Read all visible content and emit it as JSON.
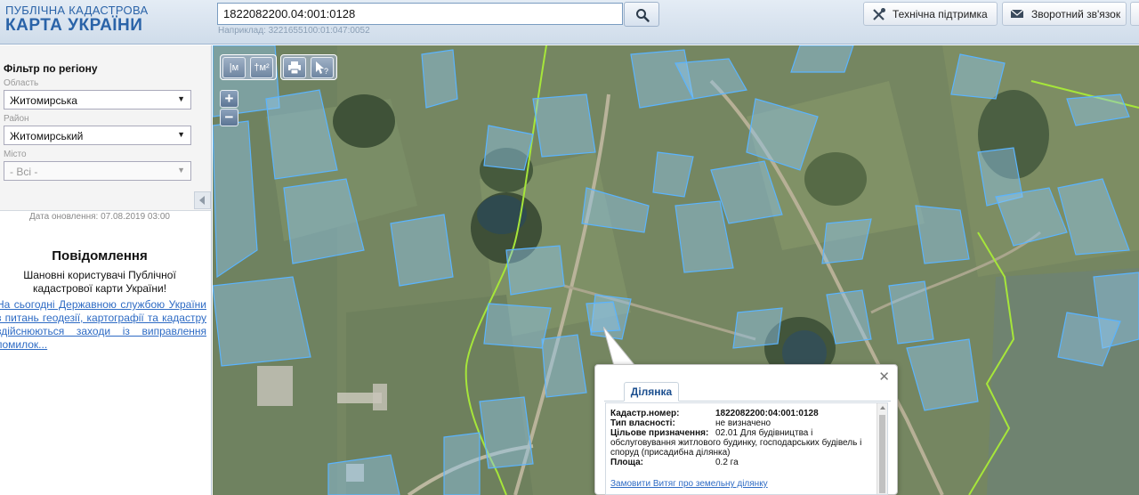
{
  "header": {
    "logo_line1": "ПУБЛІЧНА КАДАСТРОВА",
    "logo_line2": "КАРТА УКРАЇНИ",
    "search_value": "1822082200.04:001:0128",
    "search_icon": "magnifier-icon",
    "example_text": "Наприклад: 3221655100:01:047:0052",
    "support_label": "Технічна підтримка",
    "support_icon": "tools-icon",
    "feedback_label": "Зворотний зв'язок",
    "feedback_icon": "envelope-icon"
  },
  "filter": {
    "title": "Фільтр по регіону",
    "oblast_label": "Область",
    "oblast_value": "Житомирська",
    "rayon_label": "Район",
    "rayon_value": "Житомирський",
    "misto_label": "Місто",
    "misto_value": "- Всі -"
  },
  "sidebar": {
    "update_date": "Дата оновлення: 07.08.2019 03:00",
    "message_title": "Повідомлення",
    "message_body": "Шановні користувачі Публічної кадастрової карти України!",
    "message_link": "На сьогодні Державною службою України з питань геодезії, картографії та кадастру здійснюються заходи із виправлення помилок..."
  },
  "map_tools": {
    "measure_length": "м",
    "measure_area": "м²",
    "print_icon": "printer-icon",
    "info_icon": "pointer-question-icon",
    "zoom_in": "+",
    "zoom_out": "−"
  },
  "popup": {
    "tab_label": "Ділянка",
    "close_label": "✕",
    "fields": {
      "cadastral_label": "Кадастр.номер:",
      "cadastral_value": "1822082200:04:001:0128",
      "ownership_label": "Тип власності:",
      "ownership_value": "не визначено",
      "purpose_label": "Цільове призначення:",
      "purpose_value": "02.01 Для будівництва і обслуговування житлового будинку, господарських будівель і споруд (присадибна ділянка)",
      "area_label": "Площа:",
      "area_value": "0.2 га"
    },
    "order_link": "Замовити Витяг про земельну ділянку"
  },
  "colors": {
    "parcel_stroke": "#5ab4ff",
    "parcel_fill": "#8ec6ee",
    "boundary_green": "#a6e63a",
    "header_blue": "#2a63a8",
    "link_blue": "#2e6bc4"
  }
}
